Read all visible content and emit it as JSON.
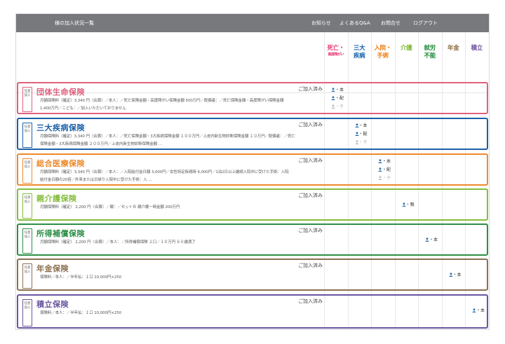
{
  "topbar": {
    "page_title": "様の加入状況一覧",
    "nav": [
      "お知らせ",
      "よくあるQ&A",
      "お問合せ",
      "ログアウト"
    ]
  },
  "columns": [
    {
      "label": "死亡・",
      "sub": "高度障がい",
      "color": "#e6336f"
    },
    {
      "label": "三大\n疾病",
      "sub": "",
      "color": "#0f5fa9"
    },
    {
      "label": "入院・\n手術",
      "sub": "",
      "color": "#ee7c12"
    },
    {
      "label": "介護",
      "sub": "",
      "color": "#7ab82d"
    },
    {
      "label": "就労\n不能",
      "sub": "",
      "color": "#1f8a3b"
    },
    {
      "label": "年金",
      "sub": "",
      "color": "#8a6a3c"
    },
    {
      "label": "積立",
      "sub": "",
      "color": "#6c4fa0"
    }
  ],
  "tag_text": "任意加入",
  "cards": [
    {
      "title": "団体生命保険",
      "color": "#e0607e",
      "status": "ご加入済み",
      "desc": [
        "月額保険料（確定）3,340 円（合算）／本人：／死亡保険金額・高度障がい保険金額 500万円／配偶者：／死亡保険金額・高度障がい保険金額",
        "1,400万円／こども：／加入いただいておりません"
      ],
      "indicators": [
        {
          "label": "本",
          "active": true
        },
        {
          "label": "配",
          "active": true
        },
        {
          "label": "子",
          "active": false
        }
      ]
    },
    {
      "title": "三大疾病保険",
      "color": "#1a5fa8",
      "status": "ご加入済み",
      "desc": [
        "月額保険料（確定）3,340 円（合算）／本人：／死亡保険金額・3大疾病保険金額 １００万円／上皮内新生物診断保険金額 １０万円／配偶者：／死亡",
        "保険金額・3大疾病保険金額 ２００万円／上皮内新生物診断保険金額 …"
      ],
      "indicators": [
        {
          "label": "本",
          "active": true
        },
        {
          "label": "配",
          "active": true
        },
        {
          "label": "子",
          "active": false
        }
      ]
    },
    {
      "title": "総合医療保険",
      "color": "#ee8a2c",
      "status": "ご加入済み",
      "desc": [
        "月額保険料（確定）3,340 円（合算）／本人：／入院給付金日額 3,000円／女性特定疾病時 6,000円／1泊2日以上継続入院中に受けた手術：入院",
        "給付金日額の20倍／外来または日帰り入院中に受けた手術：入 …"
      ],
      "indicators": [
        {
          "label": "本",
          "active": true
        },
        {
          "label": "配",
          "active": true
        },
        {
          "label": "子",
          "active": false
        }
      ]
    },
    {
      "title": "親介護保険",
      "color": "#84bd3b",
      "status": "ご加入済み",
      "desc": [
        "月額保険料（確定） 2,200 円（合算）／親：／セットＢ 親介護一時金額 200万円"
      ],
      "indicators": [
        {
          "label": "親",
          "active": true
        }
      ]
    },
    {
      "title": "所得補償保険",
      "color": "#2b8f45",
      "status": "ご加入済み",
      "desc": [
        "月額保険料（確定） 2,200 円（合算）／本人：／所得補償保険 ２口／１０万円 ６０歳満了"
      ],
      "indicators": [
        {
          "label": "本",
          "active": true
        }
      ]
    },
    {
      "title": "年金保険",
      "color": "#8b7050",
      "status": "ご加入済み",
      "desc": [
        "保険料／本人：／半年払：１口 10,000円×250"
      ],
      "indicators": [
        {
          "label": "本",
          "active": true
        }
      ]
    },
    {
      "title": "積立保険",
      "color": "#6a55a0",
      "status": "ご加入済み",
      "desc": [
        "保険料／本人：／半年払：１口 10,000円×250"
      ],
      "indicators": [
        {
          "label": "本",
          "active": true
        }
      ]
    }
  ]
}
